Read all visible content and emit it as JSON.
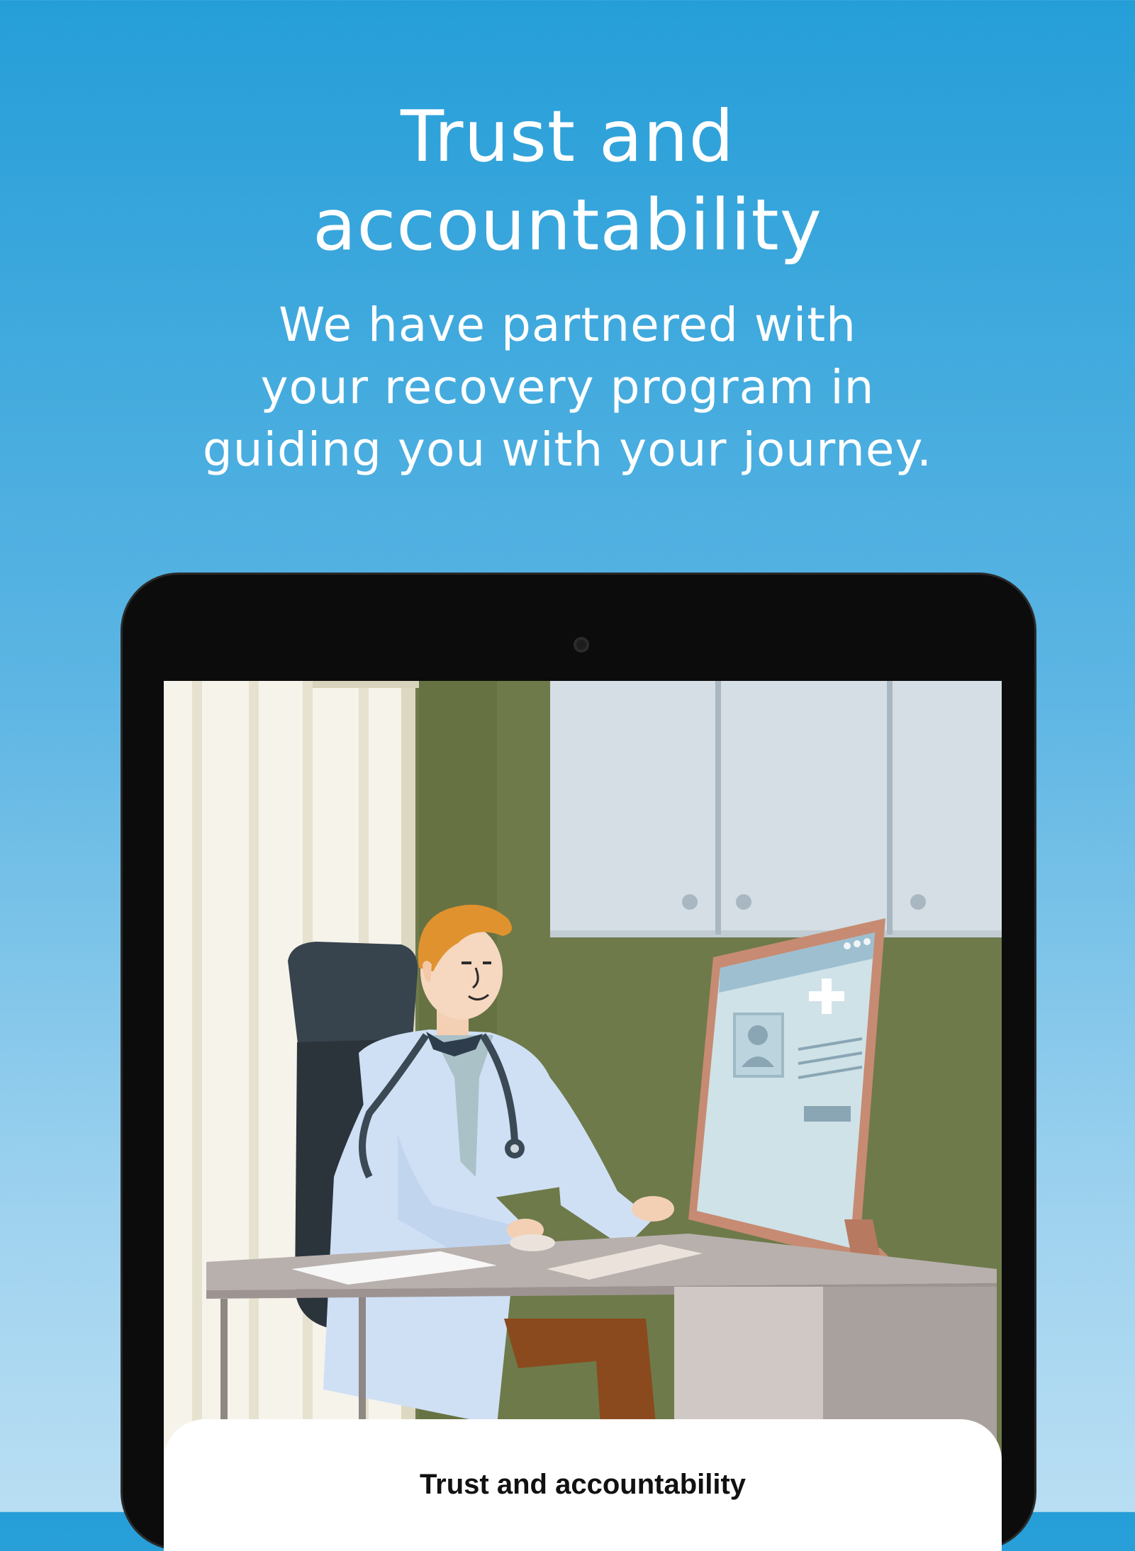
{
  "headline": {
    "line1": "Trust and",
    "line2": "accountability"
  },
  "subtitle": {
    "line1": "We have partnered with",
    "line2": "your recovery program in",
    "line3": "guiding you with your journey."
  },
  "device": {
    "illustration": "doctor-at-desk-illustration",
    "sheet_title": "Trust and accountability"
  },
  "colors": {
    "background_top": "#259ed8",
    "background_bottom": "#b9def3",
    "tablet_bezel": "#0c0c0c",
    "wall": "#6e7a4a",
    "doctor_coat": "#cfe0f5",
    "doctor_hair": "#e0922e"
  }
}
